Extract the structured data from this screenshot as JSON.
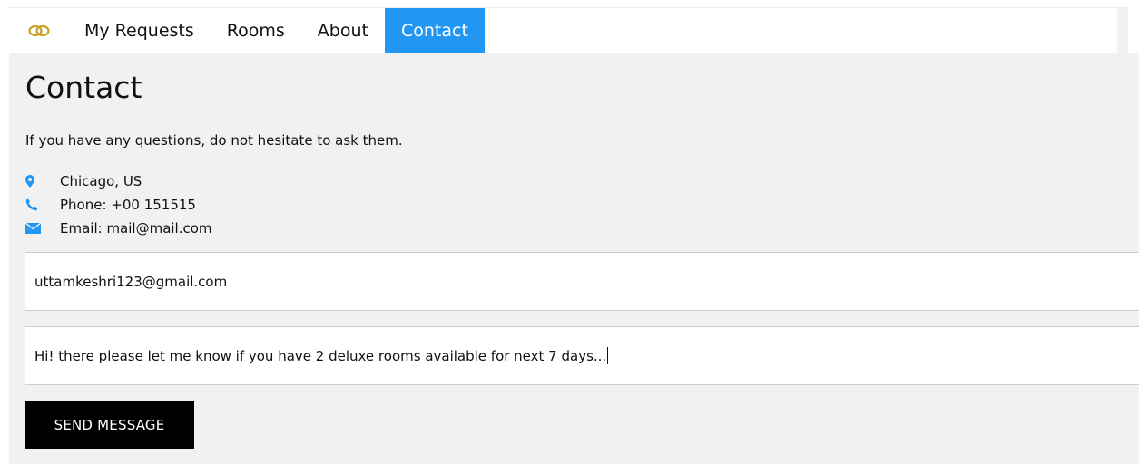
{
  "nav": {
    "logo_icon": "interlocking-rings-icon",
    "items": [
      {
        "label": "My Requests"
      },
      {
        "label": "Rooms"
      },
      {
        "label": "About"
      },
      {
        "label": "Contact"
      }
    ],
    "active_index": 3
  },
  "colors": {
    "accent": "#2196F3",
    "logo": "#C9A227",
    "content_bg": "#f1f1f1",
    "button_bg": "#000000"
  },
  "contact": {
    "title": "Contact",
    "intro": "If you have any questions, do not hesitate to ask them.",
    "info": [
      {
        "icon": "map-marker-icon",
        "text": "Chicago, US"
      },
      {
        "icon": "phone-icon",
        "text": "Phone: +00 151515"
      },
      {
        "icon": "envelope-icon",
        "text": "Email: mail@mail.com"
      }
    ]
  },
  "form": {
    "email_value": "uttamkeshri123@gmail.com",
    "message_value": "Hi! there please let me know if you have 2 deluxe rooms available for next 7 days...",
    "submit_label": "SEND MESSAGE"
  }
}
